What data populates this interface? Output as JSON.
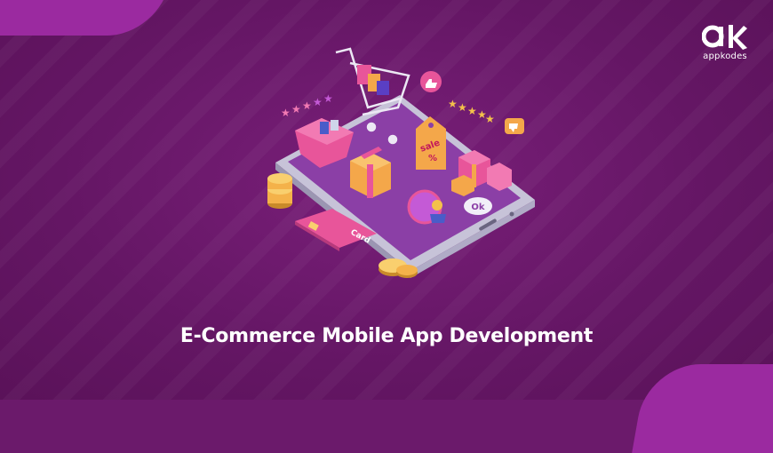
{
  "brand": {
    "logo_text": "appkodes"
  },
  "hero": {
    "title": "E-Commerce Mobile App Development"
  },
  "illustration": {
    "sale_tag": {
      "word": "sale",
      "symbol": "%"
    },
    "card_label": "Card",
    "ok_badge": "Ok",
    "icons": [
      "shopping-cart-icon",
      "like-icon",
      "dislike-icon",
      "gift-box-icon",
      "coin-stack-icon",
      "credit-card-icon",
      "star-rating-icon",
      "smartphone-icon"
    ]
  },
  "colors": {
    "background": "#6b1a6b",
    "accent_pink": "#e8559a",
    "accent_orange": "#f4a74a",
    "text": "#ffffff"
  }
}
